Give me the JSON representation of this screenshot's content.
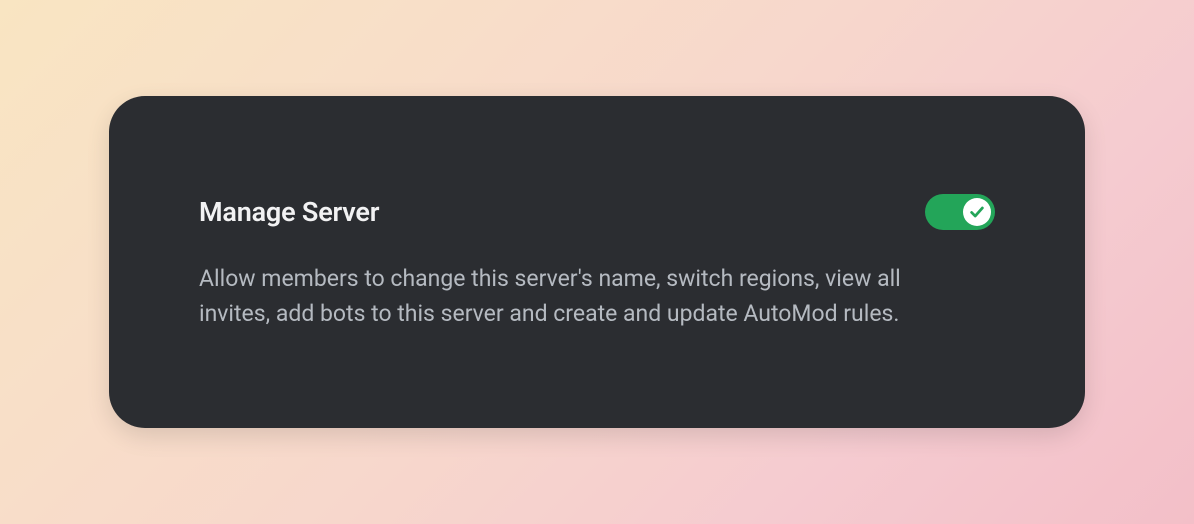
{
  "permission": {
    "title": "Manage Server",
    "description": "Allow members to change this server's name, switch regions, view all invites, add bots to this server and create and update AutoMod rules.",
    "enabled": true
  },
  "colors": {
    "card_bg": "#2b2d31",
    "title_text": "#f2f2f3",
    "description_text": "#b5bac1",
    "toggle_on": "#23a559",
    "toggle_knob": "#ffffff"
  }
}
